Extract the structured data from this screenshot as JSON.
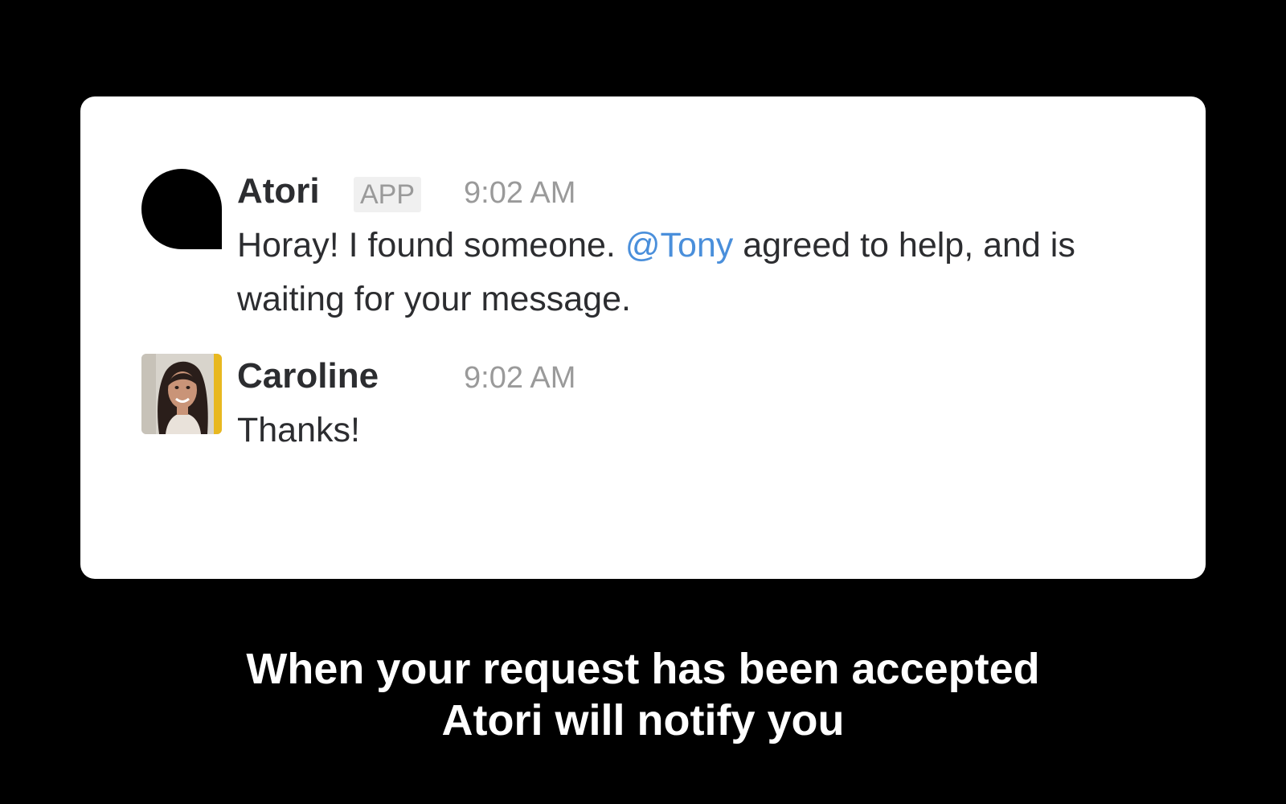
{
  "messages": [
    {
      "sender": "Atori",
      "badge": "APP",
      "time": "9:02 AM",
      "text_before": "Horay! I found someone. ",
      "mention": "@Tony",
      "text_after": " agreed to help, and is waiting for your message."
    },
    {
      "sender": "Caroline",
      "time": "9:02 AM",
      "text": "Thanks!"
    }
  ],
  "caption": {
    "line1": "When your request has been accepted",
    "line2": "Atori will notify you"
  },
  "colors": {
    "background": "#000000",
    "card": "#ffffff",
    "mention": "#4a8fdb",
    "timestamp": "#9a9a9a",
    "text": "#2c2d30"
  },
  "icons": {
    "atori_avatar": "atori-logo-icon",
    "caroline_avatar": "user-photo"
  }
}
